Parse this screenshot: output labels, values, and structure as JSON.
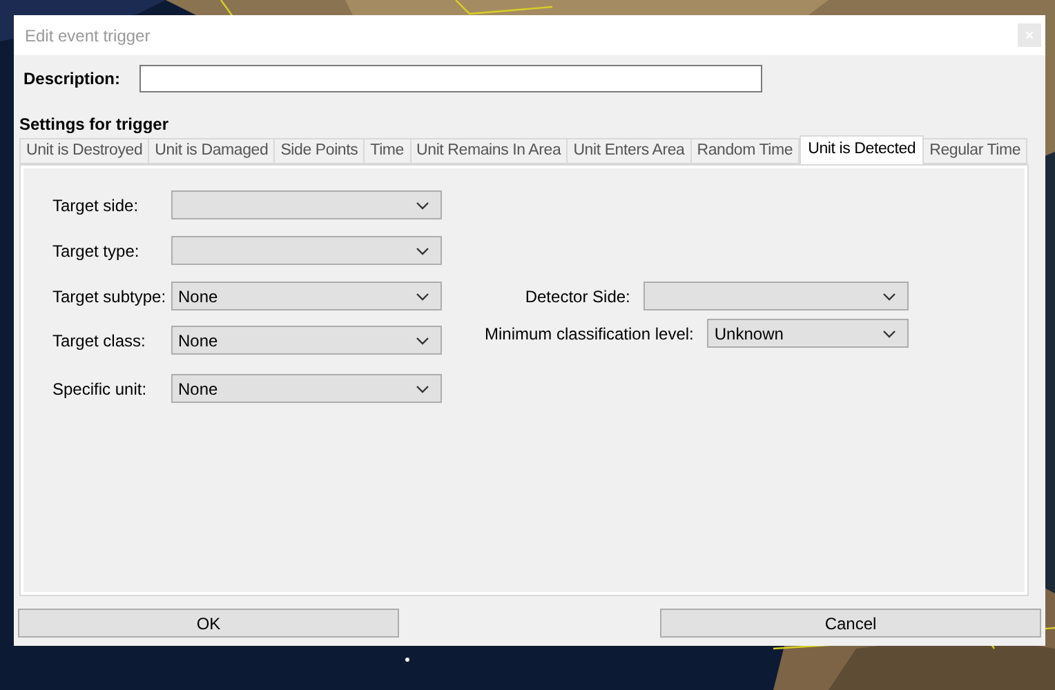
{
  "window": {
    "title": "Edit event trigger"
  },
  "description": {
    "label": "Description:"
  },
  "settings_heading": "Settings for trigger",
  "tabs": [
    {
      "label": "Unit is Destroyed",
      "selected": false
    },
    {
      "label": "Unit is Damaged",
      "selected": false
    },
    {
      "label": "Side Points",
      "selected": false
    },
    {
      "label": "Time",
      "selected": false
    },
    {
      "label": "Unit Remains In Area",
      "selected": false
    },
    {
      "label": "Unit Enters Area",
      "selected": false
    },
    {
      "label": "Random Time",
      "selected": false
    },
    {
      "label": "Unit is Detected",
      "selected": true
    },
    {
      "label": "Regular Time",
      "selected": false
    }
  ],
  "left_fields": [
    {
      "label": "Target side:"
    },
    {
      "label": "Target type:"
    },
    {
      "label": "Target subtype:",
      "value": "None"
    },
    {
      "label": "Target class:",
      "value": "None"
    },
    {
      "label": "Specific unit:",
      "value": "None"
    }
  ],
  "right_fields": [
    {
      "label": "Detector Side:"
    },
    {
      "label": "Minimum classification level:",
      "value": "Unknown"
    }
  ],
  "buttons": [
    "OK",
    "Cancel"
  ]
}
